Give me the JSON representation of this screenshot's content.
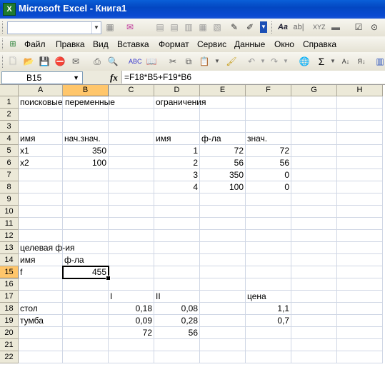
{
  "window": {
    "title": "Microsoft Excel - Книга1"
  },
  "menu": [
    "Файл",
    "Правка",
    "Вид",
    "Вставка",
    "Формат",
    "Сервис",
    "Данные",
    "Окно",
    "Справка"
  ],
  "formula_bar": {
    "name_box": "B15",
    "fx": "fx",
    "formula": "=F18*B5+F19*B6"
  },
  "columns": [
    "A",
    "B",
    "C",
    "D",
    "E",
    "F",
    "G",
    "H"
  ],
  "rows": [
    "1",
    "2",
    "3",
    "4",
    "5",
    "6",
    "7",
    "8",
    "9",
    "10",
    "11",
    "12",
    "13",
    "14",
    "15",
    "16",
    "17",
    "18",
    "19",
    "20",
    "21",
    "22"
  ],
  "selected_cell": "B15",
  "cells": {
    "A1": "поисковые переменные",
    "D1": "ограничения",
    "A4": "имя",
    "B4": "нач.знач.",
    "D4": "имя",
    "E4": "ф-ла",
    "F4": "знач.",
    "A5": "x1",
    "B5": "350",
    "D5": "1",
    "E5": "72",
    "F5": "72",
    "A6": "x2",
    "B6": "100",
    "D6": "2",
    "E6": "56",
    "F6": "56",
    "D7": "3",
    "E7": "350",
    "F7": "0",
    "D8": "4",
    "E8": "100",
    "F8": "0",
    "A13": "целевая ф-ия",
    "A14": "имя",
    "B14": "ф-ла",
    "A15": "f",
    "B15": "455",
    "C17": "I",
    "D17": "II",
    "F17": "цена",
    "A18": "стол",
    "C18": "0,18",
    "D18": "0,08",
    "F18": "1,1",
    "A19": "тумба",
    "C19": "0,09",
    "D19": "0,28",
    "F19": "0,7",
    "C20": "72",
    "D20": "56"
  }
}
